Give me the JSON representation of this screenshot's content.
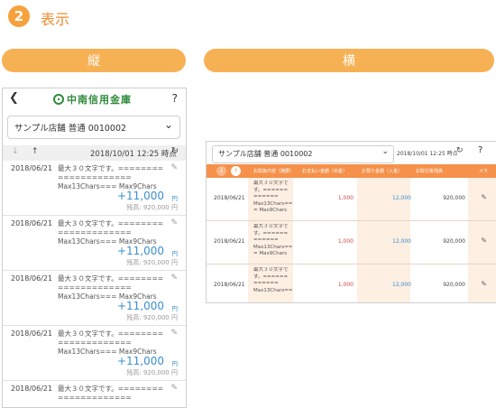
{
  "header": {
    "step_number": "2",
    "title": "表示",
    "portrait_label": "縦",
    "landscape_label": "横"
  },
  "portrait": {
    "back_icon": "chevron-left-icon",
    "brand_name": "中南信用金庫",
    "help_label": "?",
    "account_selector": "サンプル店舗 普通 0010002",
    "sort_down_label": "↓",
    "sort_up_label": "↑",
    "updated_at": "2018/10/01 12:25 時点",
    "refresh_label": "↻",
    "transactions": [
      {
        "date": "2018/06/21",
        "description": "最大３０文字です。========\n=============\nMax13Chars=== Max9Chars",
        "amount": "+11,000",
        "yen": "円",
        "balance": "残高: 920,000 円"
      },
      {
        "date": "2018/06/21",
        "description": "最大３０文字です。========\n=============\nMax13Chars=== Max9Chars",
        "amount": "+11,000",
        "yen": "円",
        "balance": "残高: 920,000 円"
      },
      {
        "date": "2018/06/21",
        "description": "最大３０文字です。========\n=============\nMax13Chars=== Max9Chars",
        "amount": "+11,000",
        "yen": "円",
        "balance": "残高: 920,000 円"
      },
      {
        "date": "2018/06/21",
        "description": "最大３０文字です。========\n=============\nMax13Chars=== Max9Chars",
        "amount": "+11,000",
        "yen": "円",
        "balance": "残高: 920,000 円"
      },
      {
        "date": "2018/06/21",
        "description": "最大３０文字です。========\n=============",
        "amount": "",
        "yen": "",
        "balance": ""
      }
    ]
  },
  "landscape": {
    "account_selector": "サンプル店舗 普通 0010002",
    "updated_at": "2018/10/01 12:25 時点",
    "refresh_label": "↻",
    "help_label": "?",
    "sort_down_label": "↓",
    "sort_up_label": "↑",
    "columns": [
      "お取扱内容（摘要）",
      "お支払い金額（出金）",
      "お預り金額（入金）",
      "お取引後残高",
      "メモ"
    ],
    "rows": [
      {
        "date": "2018/06/21",
        "description": "最大３０文字で\nす。======\n======\nMax13Chars===\n= Max9Chars",
        "out": "1,000",
        "in": "12,000",
        "balance": "920,000"
      },
      {
        "date": "2018/06/21",
        "description": "最大３０文字で\nす。======\n======\nMax13Chars==\n= Max9Chars",
        "out": "1,000",
        "in": "12,000",
        "balance": "920,000"
      },
      {
        "date": "2018/06/21",
        "description": "最大３０文字で\nす。======\n======\nMax13Chars==\n",
        "out": "1,000",
        "in": "12,000",
        "balance": "920,000"
      }
    ]
  },
  "colors": {
    "accent_orange": "#f5914a",
    "pill_orange": "#f7b155",
    "brand_green": "#2e8b3a",
    "deposit_blue": "#3a8fcf",
    "withdraw_red": "#d34646"
  }
}
